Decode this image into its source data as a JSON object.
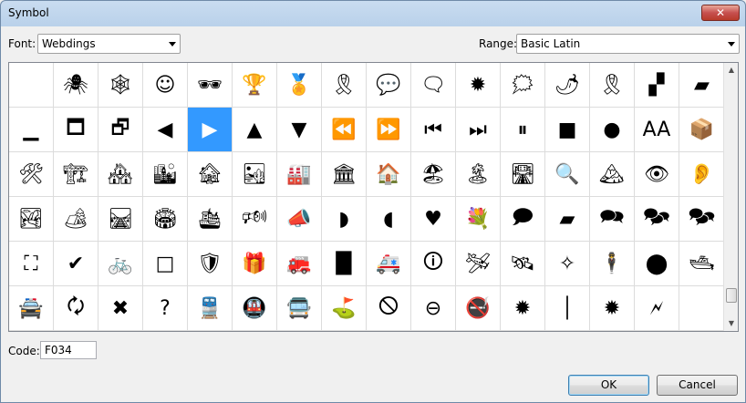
{
  "window": {
    "title": "Symbol",
    "close_glyph": "✕"
  },
  "font": {
    "label": "Font:",
    "value": "Webdings"
  },
  "range": {
    "label": "Range:",
    "value": "Basic Latin"
  },
  "grid": {
    "selected_index": 20,
    "rows": [
      [
        {
          "glyph": "",
          "icon": "blank"
        },
        {
          "glyph": "🕷",
          "icon": "spider-icon"
        },
        {
          "glyph": "🕸",
          "icon": "spider-web-icon"
        },
        {
          "glyph": "☺",
          "icon": "no-smiley-icon"
        },
        {
          "glyph": "🕶",
          "icon": "sunglasses-icon"
        },
        {
          "glyph": "🏆",
          "icon": "trophy-icon"
        },
        {
          "glyph": "🏅",
          "icon": "medal-icon"
        },
        {
          "glyph": "🎗",
          "icon": "ribbon-scroll-icon"
        },
        {
          "glyph": "💬",
          "icon": "speech-bubble-icon"
        },
        {
          "glyph": "🗨",
          "icon": "speech-bubble-left-icon"
        },
        {
          "glyph": "✹",
          "icon": "starburst-icon"
        },
        {
          "glyph": "🗯",
          "icon": "anger-bubble-icon"
        },
        {
          "glyph": "🌶",
          "icon": "chili-pepper-icon"
        },
        {
          "glyph": "🎗",
          "icon": "awareness-ribbon-icon"
        },
        {
          "glyph": "▞",
          "icon": "checker-icon"
        },
        {
          "glyph": "▰",
          "icon": "slash-bar-icon"
        }
      ],
      [
        {
          "glyph": "▁",
          "icon": "minimize-icon"
        },
        {
          "glyph": "🗖",
          "icon": "maximize-icon"
        },
        {
          "glyph": "🗗",
          "icon": "restore-icon"
        },
        {
          "glyph": "◀",
          "icon": "triangle-left-icon"
        },
        {
          "glyph": "▶",
          "icon": "triangle-right-icon"
        },
        {
          "glyph": "▲",
          "icon": "triangle-up-icon"
        },
        {
          "glyph": "▼",
          "icon": "triangle-down-icon"
        },
        {
          "glyph": "⏪",
          "icon": "rewind-icon"
        },
        {
          "glyph": "⏩",
          "icon": "fast-forward-icon"
        },
        {
          "glyph": "⏮",
          "icon": "skip-back-icon"
        },
        {
          "glyph": "⏭",
          "icon": "skip-forward-icon"
        },
        {
          "glyph": "⏸",
          "icon": "pause-icon"
        },
        {
          "glyph": "■",
          "icon": "stop-icon"
        },
        {
          "glyph": "●",
          "icon": "record-icon"
        },
        {
          "glyph": "AA",
          "icon": "font-size-icon"
        },
        {
          "glyph": "📦",
          "icon": "box-icon"
        }
      ],
      [
        {
          "glyph": "🛠",
          "icon": "tools-icon"
        },
        {
          "glyph": "🏗",
          "icon": "construction-icon"
        },
        {
          "glyph": "🏘",
          "icon": "houses-icon"
        },
        {
          "glyph": "🏙",
          "icon": "cityscape-icon"
        },
        {
          "glyph": "🏚",
          "icon": "derelict-house-icon"
        },
        {
          "glyph": "🏜",
          "icon": "desert-icon"
        },
        {
          "glyph": "🏭",
          "icon": "factory-icon"
        },
        {
          "glyph": "🏛",
          "icon": "classical-building-icon"
        },
        {
          "glyph": "🏠",
          "icon": "house-icon"
        },
        {
          "glyph": "🏖",
          "icon": "beach-umbrella-icon"
        },
        {
          "glyph": "🏝",
          "icon": "island-icon"
        },
        {
          "glyph": "🛣",
          "icon": "motorway-icon"
        },
        {
          "glyph": "🔍",
          "icon": "magnifier-icon"
        },
        {
          "glyph": "🏔",
          "icon": "mountain-icon"
        },
        {
          "glyph": "👁",
          "icon": "eye-icon"
        },
        {
          "glyph": "👂",
          "icon": "ear-icon"
        }
      ],
      [
        {
          "glyph": "🏞",
          "icon": "national-park-icon"
        },
        {
          "glyph": "🏕",
          "icon": "camping-icon"
        },
        {
          "glyph": "🛤",
          "icon": "railway-track-icon"
        },
        {
          "glyph": "🏟",
          "icon": "stadium-icon"
        },
        {
          "glyph": "🛳",
          "icon": "cruise-ship-icon"
        },
        {
          "glyph": "🕬",
          "icon": "bullhorn-waves-icon"
        },
        {
          "glyph": "📣",
          "icon": "megaphone-icon"
        },
        {
          "glyph": "◗",
          "icon": "speaker-right-icon"
        },
        {
          "glyph": "◖",
          "icon": "speaker-left-icon"
        },
        {
          "glyph": "♥",
          "icon": "heart-icon"
        },
        {
          "glyph": "💐",
          "icon": "bouquet-icon"
        },
        {
          "glyph": "🗩",
          "icon": "right-speech-bubble-icon"
        },
        {
          "glyph": "▰",
          "icon": "diagonal-bar-icon"
        },
        {
          "glyph": "🗪",
          "icon": "two-bubbles-icon"
        },
        {
          "glyph": "🗫",
          "icon": "three-bubbles-icon"
        },
        {
          "glyph": "🗫",
          "icon": "bubbles-group-icon"
        }
      ],
      [
        {
          "glyph": "⛶",
          "icon": "dashed-square-icon"
        },
        {
          "glyph": "✔",
          "icon": "check-mark-icon"
        },
        {
          "glyph": "🚲",
          "icon": "bicycle-icon"
        },
        {
          "glyph": "□",
          "icon": "white-square-icon"
        },
        {
          "glyph": "🛡",
          "icon": "shield-icon"
        },
        {
          "glyph": "🎁",
          "icon": "gift-icon"
        },
        {
          "glyph": "🚒",
          "icon": "fire-engine-icon"
        },
        {
          "glyph": "█",
          "icon": "black-rectangle-icon"
        },
        {
          "glyph": "🚑",
          "icon": "ambulance-icon"
        },
        {
          "glyph": "🛈",
          "icon": "information-icon"
        },
        {
          "glyph": "🛩",
          "icon": "small-airplane-icon"
        },
        {
          "glyph": "🛰",
          "icon": "satellite-icon"
        },
        {
          "glyph": "✧",
          "icon": "compass-star-icon"
        },
        {
          "glyph": "🕴",
          "icon": "levitating-man-icon"
        },
        {
          "glyph": "⬤",
          "icon": "black-circle-icon"
        },
        {
          "glyph": "🛥",
          "icon": "motor-boat-icon"
        }
      ],
      [
        {
          "glyph": "🚔",
          "icon": "police-car-icon"
        },
        {
          "glyph": "🗘",
          "icon": "refresh-arrows-icon"
        },
        {
          "glyph": "✖",
          "icon": "x-mark-icon"
        },
        {
          "glyph": "?",
          "icon": "question-mark-icon"
        },
        {
          "glyph": "🚆",
          "icon": "train-icon"
        },
        {
          "glyph": "🚇",
          "icon": "metro-icon"
        },
        {
          "glyph": "🚍",
          "icon": "bus-icon"
        },
        {
          "glyph": "⛳",
          "icon": "golf-flag-icon"
        },
        {
          "glyph": "🛇",
          "icon": "prohibited-icon"
        },
        {
          "glyph": "⊖",
          "icon": "no-entry-icon"
        },
        {
          "glyph": "🚭",
          "icon": "no-smoking-icon"
        },
        {
          "glyph": "✹",
          "icon": "explosion-icon"
        },
        {
          "glyph": "│",
          "icon": "vertical-line-icon"
        },
        {
          "glyph": "✹",
          "icon": "burst-icon"
        },
        {
          "glyph": "🗲",
          "icon": "lightning-icon"
        },
        {
          "glyph": "",
          "icon": "blank"
        }
      ]
    ]
  },
  "scrollbar": {
    "up_glyph": "▲",
    "down_glyph": "▼"
  },
  "code": {
    "label": "Code:",
    "value": "F034"
  },
  "buttons": {
    "ok": "OK",
    "cancel": "Cancel"
  }
}
